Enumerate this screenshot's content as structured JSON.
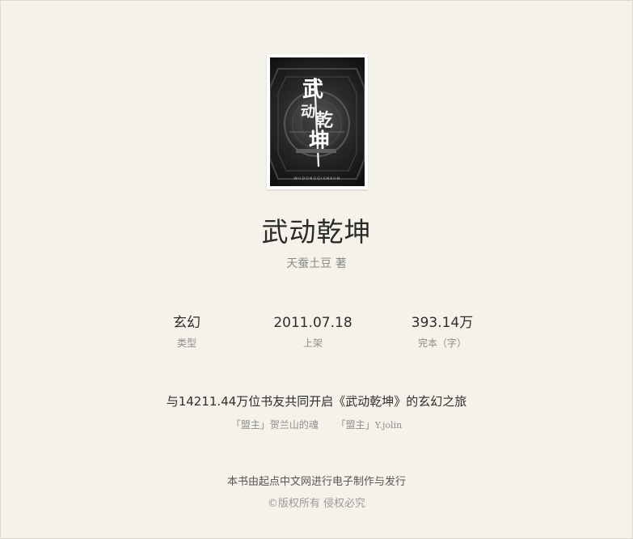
{
  "book": {
    "title": "武动乾坤",
    "author_line": "天蚕土豆 著",
    "cover": {
      "title_art": "武动乾坤",
      "bottom_text": "WUDONGQIANKUN"
    }
  },
  "stats": {
    "type": {
      "value": "玄幻",
      "label": "类型"
    },
    "date": {
      "value": "2011.07.18",
      "label": "上架"
    },
    "words": {
      "value": "393.14万",
      "label": "完本（字）"
    }
  },
  "readers_line": "与14211.44万位书友共同开启《武动乾坤》的玄幻之旅",
  "members": [
    {
      "badge": "「盟主」",
      "name": "贺兰山的魂"
    },
    {
      "badge": "「盟主」",
      "name": "Y.jolin"
    }
  ],
  "footer": {
    "publisher": "本书由起点中文网进行电子制作与发行",
    "copyright": "©版权所有 侵权必究"
  }
}
